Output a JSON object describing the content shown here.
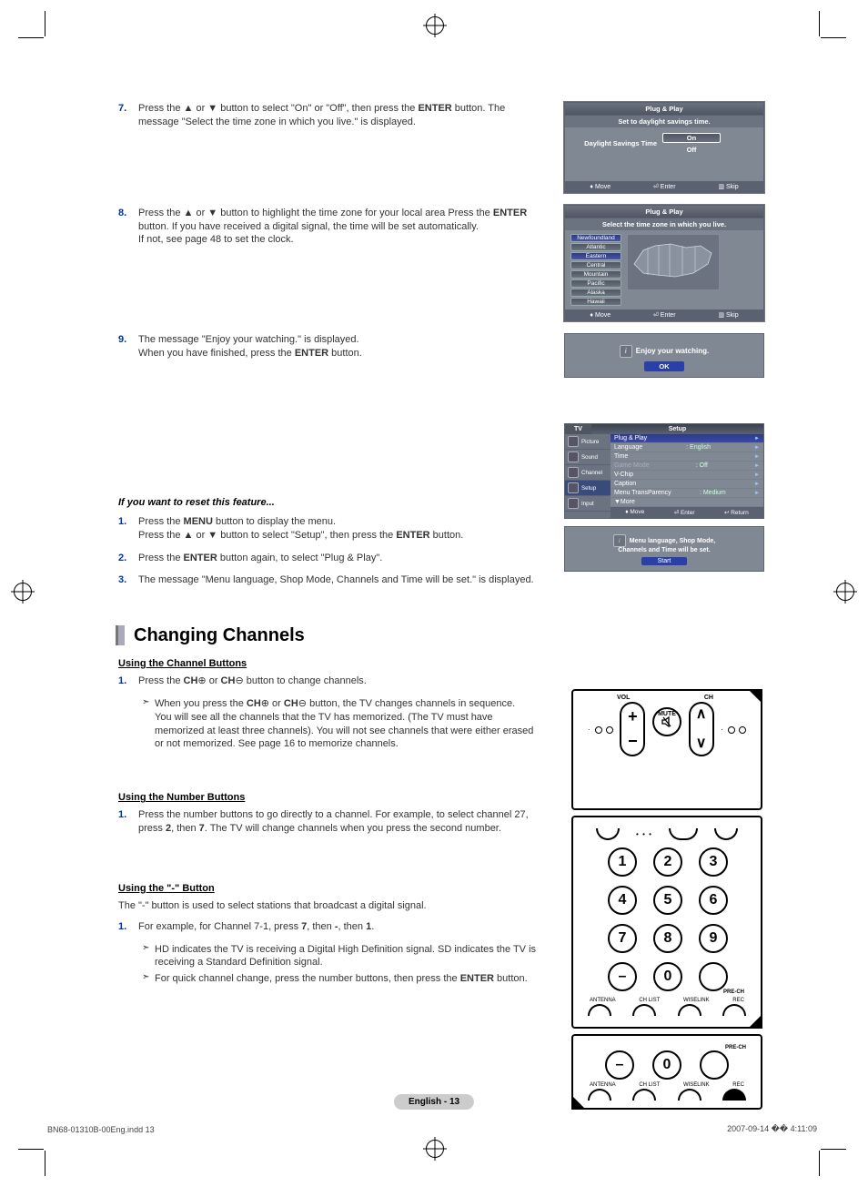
{
  "steps_top": [
    {
      "num": "7.",
      "body": "Press the ▲ or ▼ button to select \"On\" or \"Off\", then press the ENTER button. The message \"Select the time zone in which you live.\" is displayed."
    },
    {
      "num": "8.",
      "body": "Press the ▲ or ▼ button to highlight the time zone for your local area Press the ENTER button. If you have received a digital signal, the time will be set automatically. If not, see page 48 to set the clock."
    },
    {
      "num": "9.",
      "body": "The message \"Enjoy your watching.\" is displayed. When you have finished, press the ENTER button."
    }
  ],
  "reset": {
    "heading": "If you want to reset this feature...",
    "steps": [
      {
        "num": "1.",
        "body": "Press the MENU button to display the menu. Press the ▲ or ▼ button to select \"Setup\", then press the ENTER button."
      },
      {
        "num": "2.",
        "body": "Press the ENTER button again, to select \"Plug & Play\"."
      },
      {
        "num": "3.",
        "body": "The message \"Menu language, Shop Mode, Channels and Time will be set.\" is displayed."
      }
    ]
  },
  "section_title": "Changing Channels",
  "channel_buttons": {
    "heading": "Using the Channel Buttons",
    "step": {
      "num": "1.",
      "body": "Press the CH⊕ or CH⊖ button to change channels."
    },
    "notes": [
      "When you press the CH⊕ or CH⊖ button, the TV changes channels in sequence.",
      "You will see all the channels that the TV has memorized. (The TV must have memorized at least three channels). You will not see channels that were either erased or not memorized. See page 16 to memorize channels."
    ]
  },
  "number_buttons": {
    "heading": "Using the Number Buttons",
    "step": {
      "num": "1.",
      "body": "Press the number buttons to go directly to a channel. For example, to select channel 27, press 2, then 7. The TV will change channels when you press the second number."
    }
  },
  "dash_button": {
    "heading": "Using the \"-\" Button",
    "intro": "The \"-\" button is used to select stations that broadcast a digital signal.",
    "step": {
      "num": "1.",
      "body": "For example, for Channel 7-1, press 7, then -, then 1."
    },
    "notes": [
      "HD indicates the TV is receiving a Digital High Definition signal. SD indicates the TV is receiving a Standard Definition signal.",
      "For quick channel change, press the number buttons, then press the ENTER button."
    ]
  },
  "osd1": {
    "title": "Plug & Play",
    "subtitle": "Set to daylight savings time.",
    "row_label": "Daylight Savings Time",
    "opt_on": "On",
    "opt_off": "Off",
    "foot_move": "Move",
    "foot_enter": "Enter",
    "foot_skip": "Skip"
  },
  "osd2": {
    "title": "Plug & Play",
    "subtitle": "Select the time zone in which you live.",
    "zones": [
      "Newfoundland",
      "Atlantic",
      "Eastern",
      "Central",
      "Mountain",
      "Pacific",
      "Alaska",
      "Hawaii"
    ],
    "foot_move": "Move",
    "foot_enter": "Enter",
    "foot_skip": "Skip"
  },
  "osd_enjoy": {
    "msg": "Enjoy your watching.",
    "ok": "OK"
  },
  "osd_setup": {
    "header_left": "TV",
    "header_right": "Setup",
    "side": [
      "Picture",
      "Sound",
      "Channel",
      "Setup",
      "Input"
    ],
    "rows": [
      {
        "l": "Plug & Play",
        "v": ""
      },
      {
        "l": "Language",
        "v": ": English"
      },
      {
        "l": "Time",
        "v": ""
      },
      {
        "l": "Game Mode",
        "v": ": Off"
      },
      {
        "l": "V-Chip",
        "v": ""
      },
      {
        "l": "Caption",
        "v": ""
      },
      {
        "l": "Menu TransParency",
        "v": ": Medium"
      },
      {
        "l": "▼More",
        "v": ""
      }
    ],
    "foot_move": "Move",
    "foot_enter": "Enter",
    "foot_return": "Return"
  },
  "osd_start": {
    "line1": "Menu language, Shop Mode,",
    "line2": "Channels and Time will be set.",
    "start": "Start"
  },
  "remote": {
    "vol": "VOL",
    "ch": "CH",
    "mute": "MUTE",
    "antenna": "ANTENNA",
    "chlist": "CH LIST",
    "wiselink": "WISELINK",
    "rec": "REC",
    "prech": "PRE-CH"
  },
  "footer": {
    "center": "English - 13",
    "left": "BN68-01310B-00Eng.indd   13",
    "right": "2007-09-14   �� 4:11:09"
  }
}
